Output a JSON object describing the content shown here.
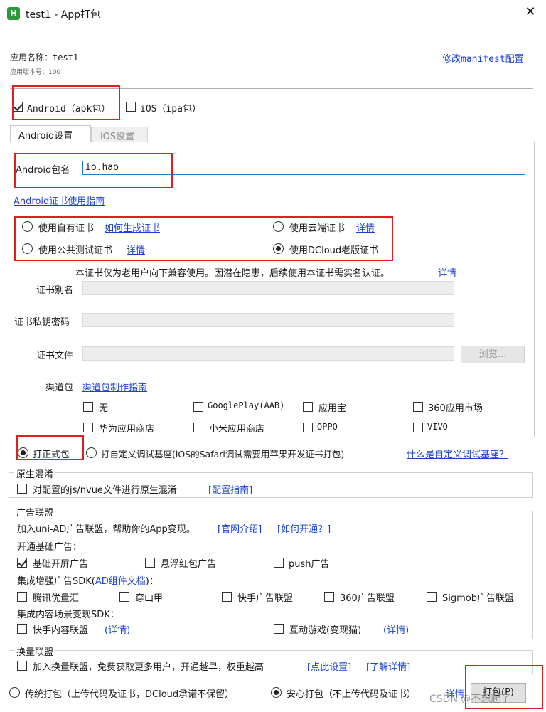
{
  "window": {
    "title": "test1 - App打包",
    "icon_letter": "H"
  },
  "app": {
    "name_label": "应用名称：test1",
    "version_label": "应用版本号：100",
    "modify_manifest_link": "修改manifest配置"
  },
  "platforms": {
    "android": {
      "label": "Android（apk包）",
      "checked": true
    },
    "ios": {
      "label": "iOS（ipa包）",
      "checked": false
    }
  },
  "tabs": [
    {
      "label": "Android设置",
      "active": true
    },
    {
      "label": "iOS设置",
      "active": false
    }
  ],
  "android": {
    "package_label": "Android包名",
    "package_value": "io.hao",
    "cert_guide_link": "Android证书使用指南",
    "cert_options": {
      "own": {
        "label": "使用自有证书",
        "link": "如何生成证书"
      },
      "cloud": {
        "label": "使用云端证书",
        "link": "详情"
      },
      "public_test": {
        "label": "使用公共测试证书",
        "link": "详情"
      },
      "dcloud_old": {
        "label": "使用DCloud老版证书"
      }
    },
    "cert_notice": "本证书仅为老用户向下兼容使用。因潜在隐患，后续使用本证书需实名认证。",
    "cert_notice_link": "详情",
    "alias_label": "证书别名",
    "password_label": "证书私钥密码",
    "file_label": "证书文件",
    "browse_button": "浏览...",
    "channel_label": "渠道包",
    "channel_link": "渠道包制作指南",
    "channels": [
      "无",
      "GooglePlay(AAB)",
      "应用宝",
      "360应用市场",
      "华为应用商店",
      "小米应用商店",
      "OPPO",
      "VIVO"
    ]
  },
  "build_type": {
    "formal": "打正式包",
    "custom_base": "打自定义调试基座(iOS的Safari调试需要用苹果开发证书打包)",
    "custom_base_link": "什么是自定义调试基座？"
  },
  "native_obfuscation": {
    "title": "原生混淆",
    "option": "对配置的js/nvue文件进行原生混淆",
    "link": "[配置指南]"
  },
  "ad_union": {
    "title": "广告联盟",
    "intro": "加入uni-AD广告联盟，帮助你的App变现。",
    "intro_link1": "[官网介绍]",
    "intro_link2": "[如何开通？]",
    "basic_title": "开通基础广告：",
    "basic_options": [
      "基础开屏广告",
      "悬浮红包广告",
      "push广告"
    ],
    "enhanced_title_prefix": "集成增强广告SDK(",
    "enhanced_title_link": "AD组件文档",
    "enhanced_title_suffix": ")：",
    "enhanced_options": [
      "腾讯优量汇",
      "穿山甲",
      "快手广告联盟",
      "360广告联盟",
      "Sigmob广告联盟"
    ],
    "content_title": "集成内容场景变现SDK：",
    "content_options": [
      "快手内容联盟",
      "互动游戏(变现猫)"
    ],
    "content_link": "(详情)"
  },
  "exchange_union": {
    "title": "换量联盟",
    "option": "加入换量联盟，免费获取更多用户，开通越早，权重越高",
    "link1": "[点此设置]",
    "link2": "[了解详情]"
  },
  "footer": {
    "traditional": "传统打包（上传代码及证书，DCloud承诺不保留）",
    "safe": "安心打包（不上传代码及证书）",
    "details_link": "详情",
    "build_button": "打包(P)",
    "watermark": "CSDN @不想起了"
  }
}
